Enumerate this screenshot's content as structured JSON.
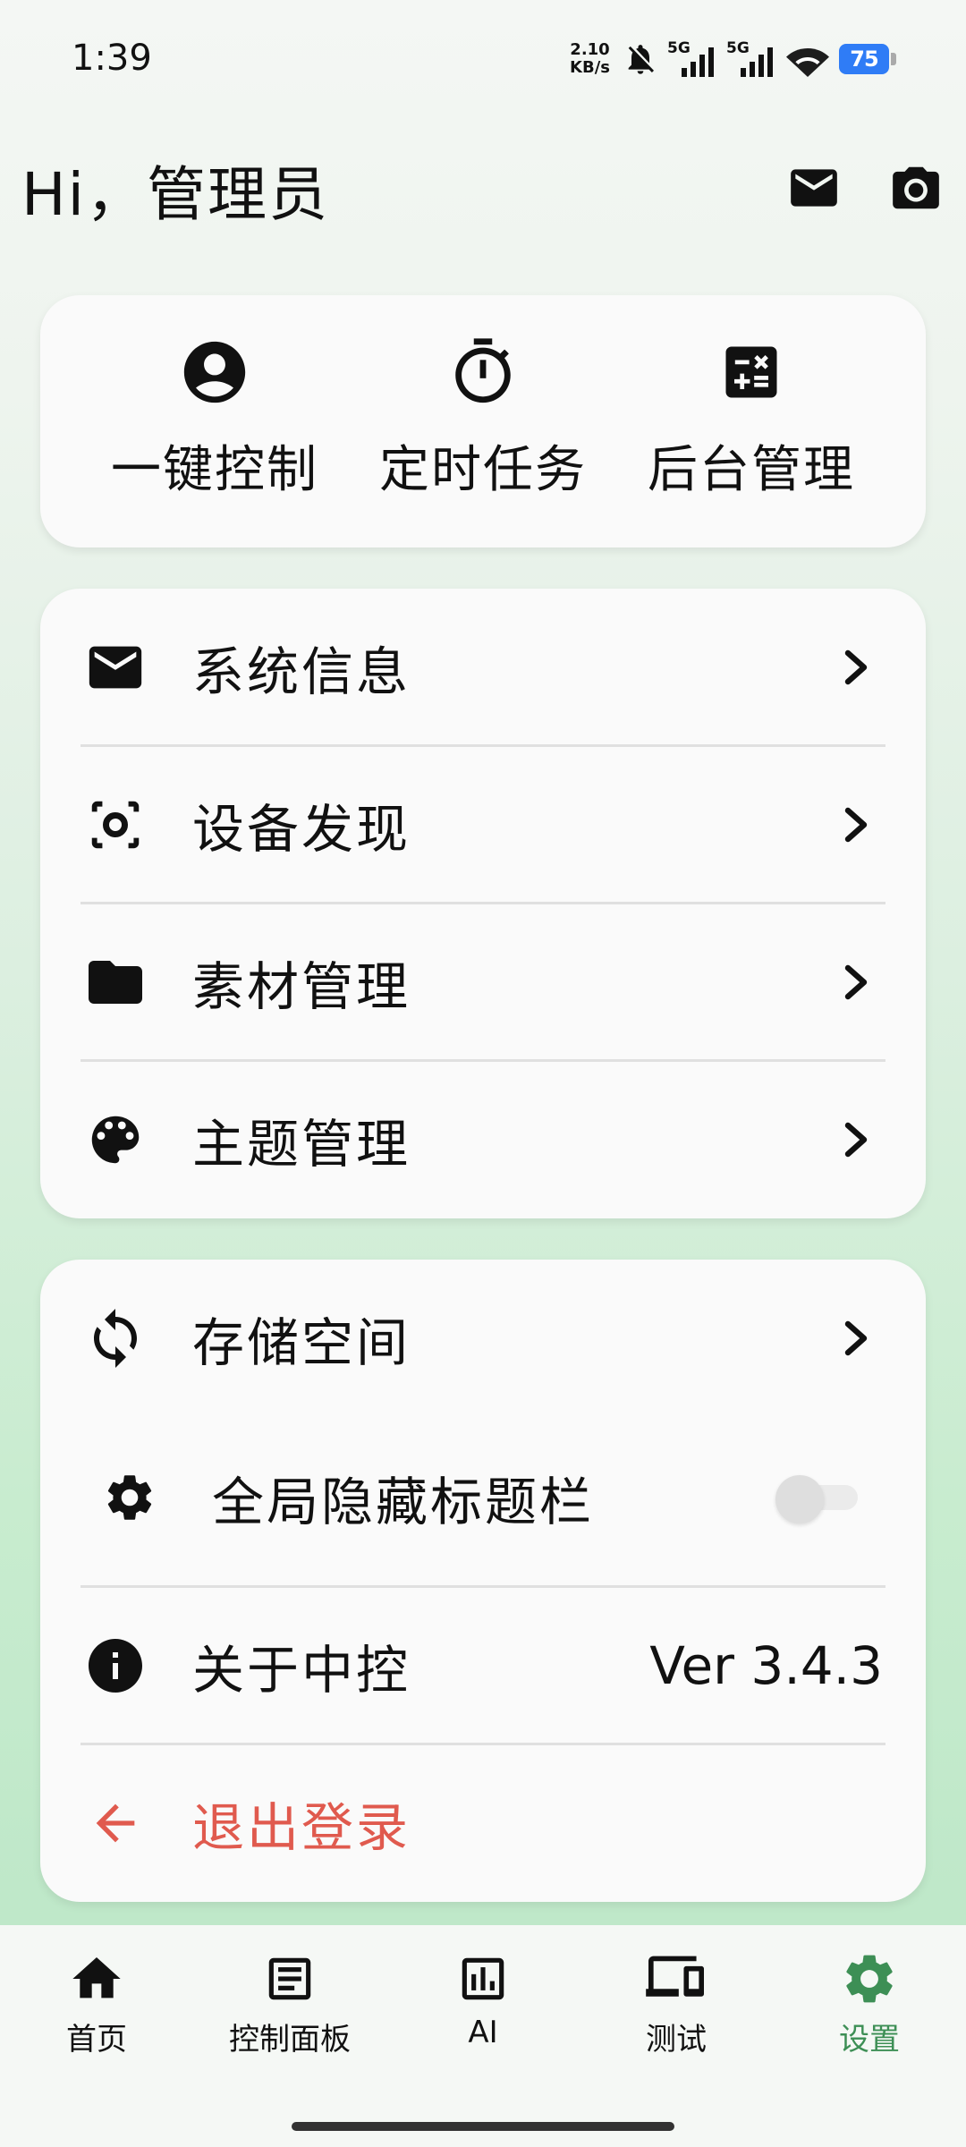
{
  "status_bar": {
    "time": "1:39",
    "net_speed_value": "2.10",
    "net_speed_unit": "KB/s",
    "sim1_label": "5G",
    "sim2_label": "5G",
    "battery": "75"
  },
  "header": {
    "greeting": "Hi，管理员",
    "mail_icon": "mail-icon",
    "camera_icon": "camera-icon"
  },
  "quick_actions": [
    {
      "label": "一键控制",
      "icon": "account-circle-icon"
    },
    {
      "label": "定时任务",
      "icon": "timer-icon"
    },
    {
      "label": "后台管理",
      "icon": "calculator-icon"
    }
  ],
  "menu_group_1": [
    {
      "label": "系统信息",
      "icon": "mail-icon"
    },
    {
      "label": "设备发现",
      "icon": "scan-icon"
    },
    {
      "label": "素材管理",
      "icon": "folder-icon"
    },
    {
      "label": "主题管理",
      "icon": "palette-icon"
    }
  ],
  "menu_group_2": {
    "storage": {
      "label": "存储空间",
      "icon": "sync-icon"
    },
    "hide_titlebar": {
      "label": "全局隐藏标题栏",
      "icon": "gear-icon",
      "enabled": false
    },
    "about": {
      "label": "关于中控",
      "icon": "info-icon",
      "version": "Ver 3.4.3"
    },
    "logout": {
      "label": "退出登录",
      "icon": "arrow-left-icon"
    }
  },
  "bottom_nav": {
    "items": [
      {
        "label": "首页",
        "icon": "home-icon"
      },
      {
        "label": "控制面板",
        "icon": "list-box-icon"
      },
      {
        "label": "AI",
        "icon": "chart-box-icon"
      },
      {
        "label": "测试",
        "icon": "devices-icon"
      },
      {
        "label": "设置",
        "icon": "gear-icon"
      }
    ],
    "active_index": 4
  },
  "colors": {
    "accent": "#3d8f55",
    "danger": "#e05a4e",
    "battery": "#2f7cf6"
  }
}
